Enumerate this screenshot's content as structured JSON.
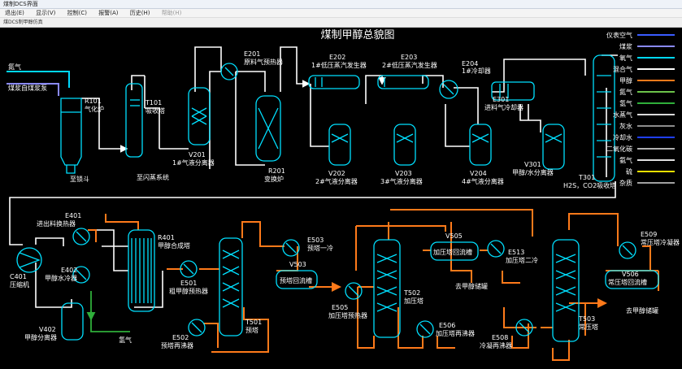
{
  "window": {
    "title": "煤制DCS界面",
    "toolbar_text": "煤DCS制甲醇仿真"
  },
  "menu": [
    {
      "label": "退出(E)",
      "enabled": true
    },
    {
      "label": "显示(V)",
      "enabled": true
    },
    {
      "label": "控制(C)",
      "enabled": true
    },
    {
      "label": "报警(A)",
      "enabled": true
    },
    {
      "label": "历史(H)",
      "enabled": true
    },
    {
      "label": "帮助(H)",
      "enabled": false
    }
  ],
  "diagram": {
    "title": "煤制甲醇总貌图",
    "inputs": {
      "n2": "氮气",
      "coal": "煤浆自煤浆泵"
    },
    "outputs": {
      "slag": "至锁斗",
      "flash": "至闪蒸系统",
      "methanol_tank": "去甲醇储罐",
      "methanol_tank2": "去甲醇储罐",
      "h2": "氢气"
    },
    "equipment": {
      "r101": [
        "R101",
        "气化炉"
      ],
      "t101": [
        "T101",
        "吸收塔"
      ],
      "v201": [
        "V201",
        "1#气液分离器"
      ],
      "e201": [
        "E201",
        "原料气预热器"
      ],
      "r201": [
        "R201",
        "变换炉"
      ],
      "e202": [
        "E202",
        "1#低压蒸汽发生器"
      ],
      "v202": [
        "V202",
        "2#气液分离器"
      ],
      "e203": [
        "E203",
        "2#低压蒸汽发生器"
      ],
      "v203": [
        "V203",
        "3#气液分离器"
      ],
      "e204": [
        "E204",
        "1#冷却器"
      ],
      "v204": [
        "V204",
        "4#气液分离器"
      ],
      "e301": [
        "E301",
        "进料气冷却器"
      ],
      "v301": [
        "V301",
        "甲醇/水分离器"
      ],
      "t301": [
        "T301",
        "H2S，CO2吸收塔"
      ],
      "e401": [
        "E401",
        "进出料换热器"
      ],
      "r401": [
        "R401",
        "甲醇合成塔"
      ],
      "c401": [
        "C401",
        "压缩机"
      ],
      "e402": [
        "E402",
        "甲醇水冷器"
      ],
      "v402": [
        "V402",
        "甲醇分离器"
      ],
      "e501": [
        "E501",
        "粗甲醇预热器"
      ],
      "e502": [
        "E502",
        "预塔再沸器"
      ],
      "t501": [
        "T501",
        "预塔"
      ],
      "e503": [
        "E503",
        "预塔一冷"
      ],
      "v503": [
        "V503",
        "预塔回流槽"
      ],
      "e505": [
        "E505",
        "加压塔预热器"
      ],
      "t502": [
        "T502",
        "加压塔"
      ],
      "v505": [
        "V505",
        "加压塔回流槽"
      ],
      "e513": [
        "E513",
        "加压塔二冷"
      ],
      "e506": [
        "E506",
        "加压塔再沸器"
      ],
      "e508": [
        "E508",
        "冷凝再沸器"
      ],
      "t503": [
        "T503",
        "常压塔"
      ],
      "e509": [
        "E509",
        "常压塔冷凝器"
      ],
      "v506": [
        "V506",
        "常压塔回流槽"
      ]
    }
  },
  "legend": [
    {
      "label": "仪表空气",
      "color": "#3a5cff"
    },
    {
      "label": "煤浆",
      "color": "#8a8aff"
    },
    {
      "label": "氧气",
      "color": "#00d8ff"
    },
    {
      "label": "混合气",
      "color": "#ffffff"
    },
    {
      "label": "甲醇",
      "color": "#ff7a1a"
    },
    {
      "label": "氮气",
      "color": "#6cc24a"
    },
    {
      "label": "氢气",
      "color": "#2fae3a"
    },
    {
      "label": "水蒸气",
      "color": "#d9d9d9"
    },
    {
      "label": "灰水",
      "color": "#8c8c8c"
    },
    {
      "label": "冷却水",
      "color": "#1f3fff"
    },
    {
      "label": "二氧化碳",
      "color": "#b0b0b0"
    },
    {
      "label": "氨气",
      "color": "#e0e0e0"
    },
    {
      "label": "硫",
      "color": "#f0e000"
    },
    {
      "label": "杂质",
      "color": "#a0a0a0"
    }
  ],
  "colors": {
    "equipment": "#00e0ff",
    "gas": "#ffffff",
    "methanol": "#ff7a1a",
    "steam": "#6cc24a"
  }
}
